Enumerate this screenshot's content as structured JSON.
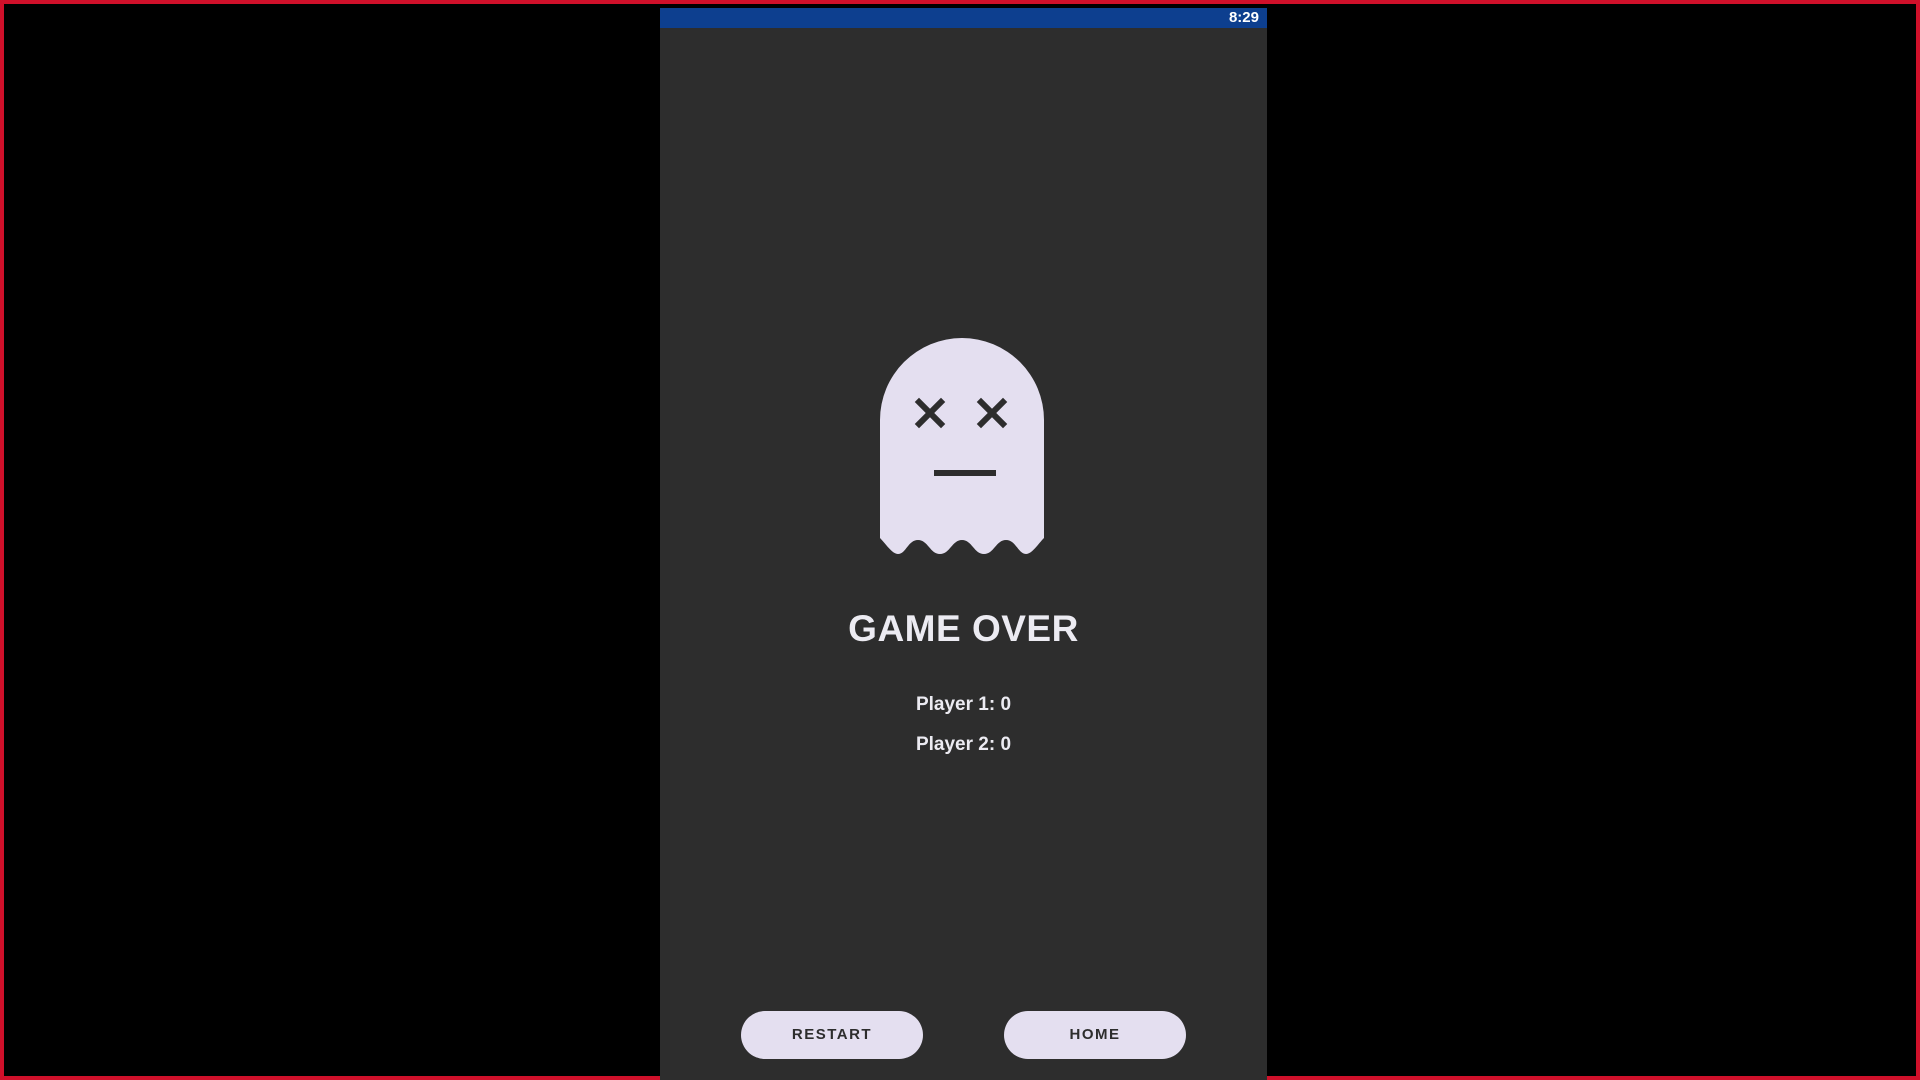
{
  "status_bar": {
    "time": "8:29",
    "color": "#0d3f8f"
  },
  "game_over": {
    "icon": "dead-ghost-icon",
    "title": "GAME OVER",
    "scores": [
      "Player 1: 0",
      "Player 2: 0"
    ]
  },
  "buttons": {
    "restart_label": "RESTART",
    "home_label": "HOME"
  },
  "colors": {
    "background": "#2d2d2d",
    "ghost": "#e4dff0",
    "text": "#ecebf2",
    "button": "#e4dff0",
    "button_text": "#2d2d2d",
    "frame_border": "#d0102a"
  }
}
